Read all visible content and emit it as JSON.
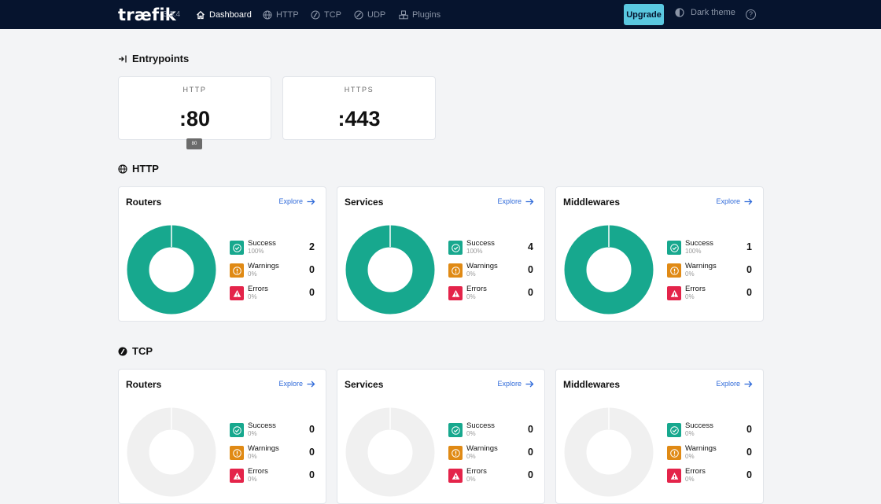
{
  "nav": {
    "brand": "træfik",
    "version": "3.3.4",
    "items": [
      {
        "label": "Dashboard",
        "icon": "home-icon"
      },
      {
        "label": "HTTP",
        "icon": "globe-icon"
      },
      {
        "label": "TCP",
        "icon": "tcp-icon"
      },
      {
        "label": "UDP",
        "icon": "udp-icon"
      },
      {
        "label": "Plugins",
        "icon": "plugins-icon"
      }
    ],
    "upgrade_label": "Upgrade",
    "theme_label": "Dark theme",
    "help_label": "?"
  },
  "entrypoints": {
    "title": "Entrypoints",
    "items": [
      {
        "name": "HTTP",
        "port": ":80"
      },
      {
        "name": "HTTPS",
        "port": ":443"
      }
    ],
    "tooltip": "80"
  },
  "http": {
    "title": "HTTP",
    "cards": [
      {
        "title": "Routers",
        "explore": "Explore",
        "success": {
          "label": "Success",
          "pct": "100%",
          "count": "2"
        },
        "warnings": {
          "label": "Warnings",
          "pct": "0%",
          "count": "0"
        },
        "errors": {
          "label": "Errors",
          "pct": "0%",
          "count": "0"
        }
      },
      {
        "title": "Services",
        "explore": "Explore",
        "success": {
          "label": "Success",
          "pct": "100%",
          "count": "4"
        },
        "warnings": {
          "label": "Warnings",
          "pct": "0%",
          "count": "0"
        },
        "errors": {
          "label": "Errors",
          "pct": "0%",
          "count": "0"
        }
      },
      {
        "title": "Middlewares",
        "explore": "Explore",
        "success": {
          "label": "Success",
          "pct": "100%",
          "count": "1"
        },
        "warnings": {
          "label": "Warnings",
          "pct": "0%",
          "count": "0"
        },
        "errors": {
          "label": "Errors",
          "pct": "0%",
          "count": "0"
        }
      }
    ]
  },
  "tcp": {
    "title": "TCP",
    "cards": [
      {
        "title": "Routers",
        "explore": "Explore",
        "success": {
          "label": "Success",
          "pct": "0%",
          "count": "0"
        },
        "warnings": {
          "label": "Warnings",
          "pct": "0%",
          "count": "0"
        },
        "errors": {
          "label": "Errors",
          "pct": "0%",
          "count": "0"
        }
      },
      {
        "title": "Services",
        "explore": "Explore",
        "success": {
          "label": "Success",
          "pct": "0%",
          "count": "0"
        },
        "warnings": {
          "label": "Warnings",
          "pct": "0%",
          "count": "0"
        },
        "errors": {
          "label": "Errors",
          "pct": "0%",
          "count": "0"
        }
      },
      {
        "title": "Middlewares",
        "explore": "Explore",
        "success": {
          "label": "Success",
          "pct": "0%",
          "count": "0"
        },
        "warnings": {
          "label": "Warnings",
          "pct": "0%",
          "count": "0"
        },
        "errors": {
          "label": "Errors",
          "pct": "0%",
          "count": "0"
        }
      }
    ]
  },
  "colors": {
    "nav_bg": "#06142e",
    "accent": "#5ac8e0",
    "success": "#17a88e",
    "warning": "#e08a15",
    "error": "#e4244a",
    "empty": "#f0f0f0",
    "link": "#2f6ad9"
  }
}
